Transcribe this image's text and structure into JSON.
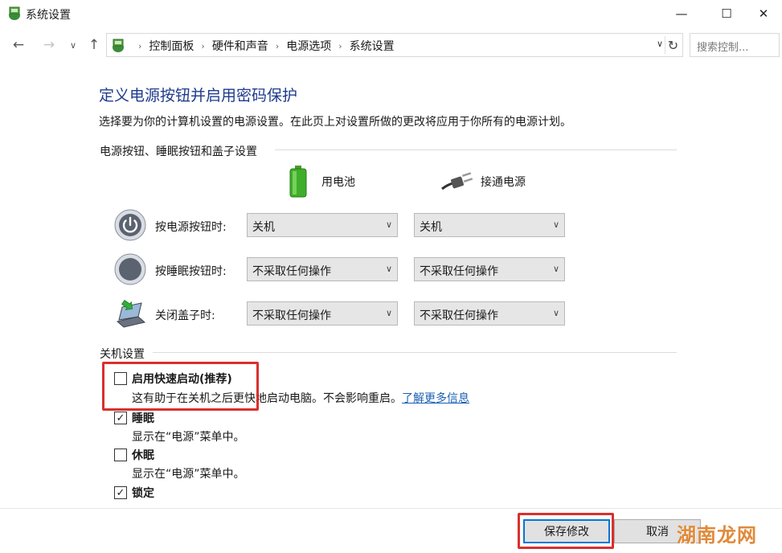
{
  "window": {
    "title": "系统设置",
    "min_glyph": "—",
    "max_glyph": "☐",
    "close_glyph": "✕"
  },
  "nav": {
    "back_glyph": "←",
    "forward_glyph": "→",
    "dropdown_glyph": "∨",
    "up_glyph": "↑",
    "breadcrumb": [
      "控制面板",
      "硬件和声音",
      "电源选项",
      "系统设置"
    ],
    "separator": "›",
    "refresh_glyph": "↻",
    "search_placeholder": "搜索控制..."
  },
  "content": {
    "title": "定义电源按钮并启用密码保护",
    "description": "选择要为你的计算机设置的电源设置。在此页上对设置所做的更改将应用于你所有的电源计划。",
    "section_buttons": "电源按钮、睡眠按钮和盖子设置",
    "col_battery": "用电池",
    "col_plugged": "接通电源",
    "rows": [
      {
        "label": "按电源按钮时:",
        "battery": "关机",
        "plugged": "关机",
        "icon": "power-icon"
      },
      {
        "label": "按睡眠按钮时:",
        "battery": "不采取任何操作",
        "plugged": "不采取任何操作",
        "icon": "sleep-icon"
      },
      {
        "label": "关闭盖子时:",
        "battery": "不采取任何操作",
        "plugged": "不采取任何操作",
        "icon": "laptop-lid-icon"
      }
    ],
    "caret": "∨",
    "section_shutdown": "关机设置",
    "options": [
      {
        "label": "启用快速启动(推荐)",
        "checked": false,
        "desc": "这有助于在关机之后更快地启动电脑。不会影响重启。",
        "link": "了解更多信息"
      },
      {
        "label": "睡眠",
        "checked": true,
        "desc": "显示在“电源”菜单中。"
      },
      {
        "label": "休眠",
        "checked": false,
        "desc": "显示在“电源”菜单中。"
      },
      {
        "label": "锁定",
        "checked": true
      }
    ],
    "check_glyph": "✓"
  },
  "footer": {
    "save": "保存修改",
    "cancel": "取消"
  },
  "watermark": "湖南龙网",
  "colors": {
    "title_blue": "#1e3b8c",
    "highlight_red": "#d9302c",
    "link_blue": "#1a5fb4",
    "watermark_orange": "#e08a3a"
  }
}
